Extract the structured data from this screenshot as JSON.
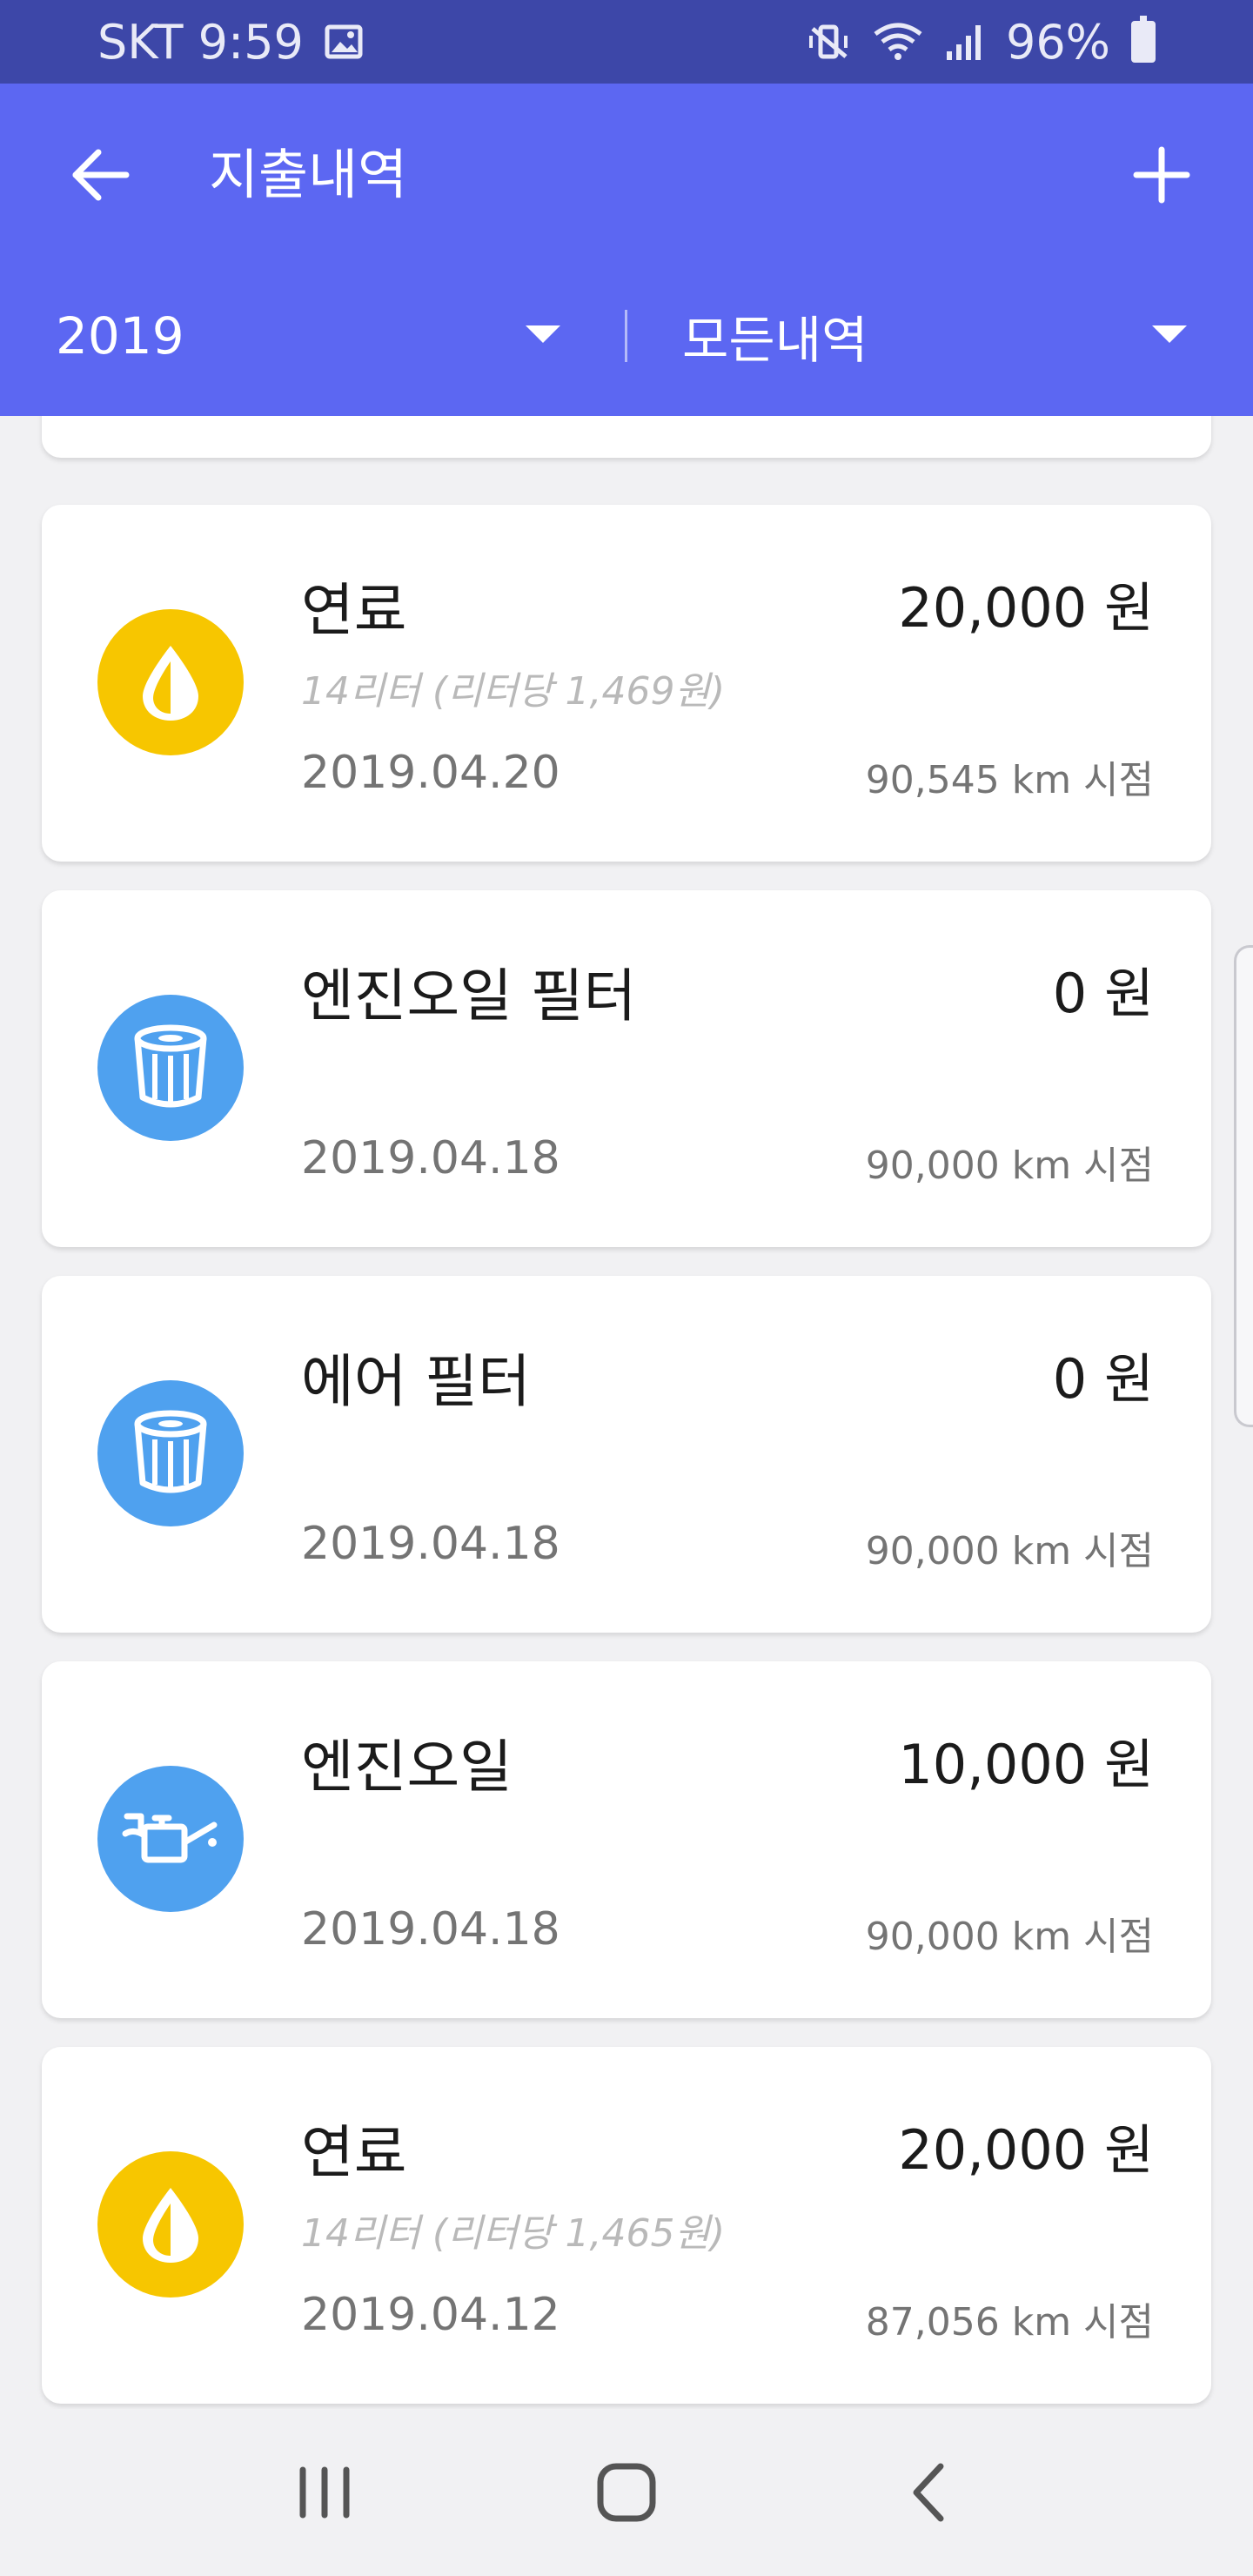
{
  "status_bar": {
    "carrier_time": "SKT 9:59",
    "battery": "96%",
    "icons": [
      "image-icon",
      "vibrate-mute-icon",
      "wifi-icon",
      "signal-icon",
      "battery-icon"
    ]
  },
  "app_bar": {
    "title": "지출내역",
    "back_icon": "arrow-left-icon",
    "add_icon": "plus-icon",
    "year_filter": "2019",
    "type_filter": "모든내역"
  },
  "entries": [
    {
      "icon": "fuel-drop-icon",
      "icon_color": "#f7c600",
      "title": "연료",
      "detail": "14리터 (리터당 1,469원)",
      "amount": "20,000 원",
      "date": "2019.04.20",
      "odometer": "90,545 km 시점"
    },
    {
      "icon": "filter-icon",
      "icon_color": "#4fa1ef",
      "title": "엔진오일 필터",
      "detail": "",
      "amount": "0 원",
      "date": "2019.04.18",
      "odometer": "90,000 km 시점"
    },
    {
      "icon": "filter-icon",
      "icon_color": "#4fa1ef",
      "title": "에어 필터",
      "detail": "",
      "amount": "0 원",
      "date": "2019.04.18",
      "odometer": "90,000 km 시점"
    },
    {
      "icon": "oil-can-icon",
      "icon_color": "#4fa1ef",
      "title": "엔진오일",
      "detail": "",
      "amount": "10,000 원",
      "date": "2019.04.18",
      "odometer": "90,000 km 시점"
    },
    {
      "icon": "fuel-drop-icon",
      "icon_color": "#f7c600",
      "title": "연료",
      "detail": "14리터 (리터당 1,465원)",
      "amount": "20,000 원",
      "date": "2019.04.12",
      "odometer": "87,056 km 시점"
    }
  ],
  "nav_bar": {
    "icons": [
      "recent-apps-icon",
      "home-icon",
      "back-icon"
    ]
  }
}
